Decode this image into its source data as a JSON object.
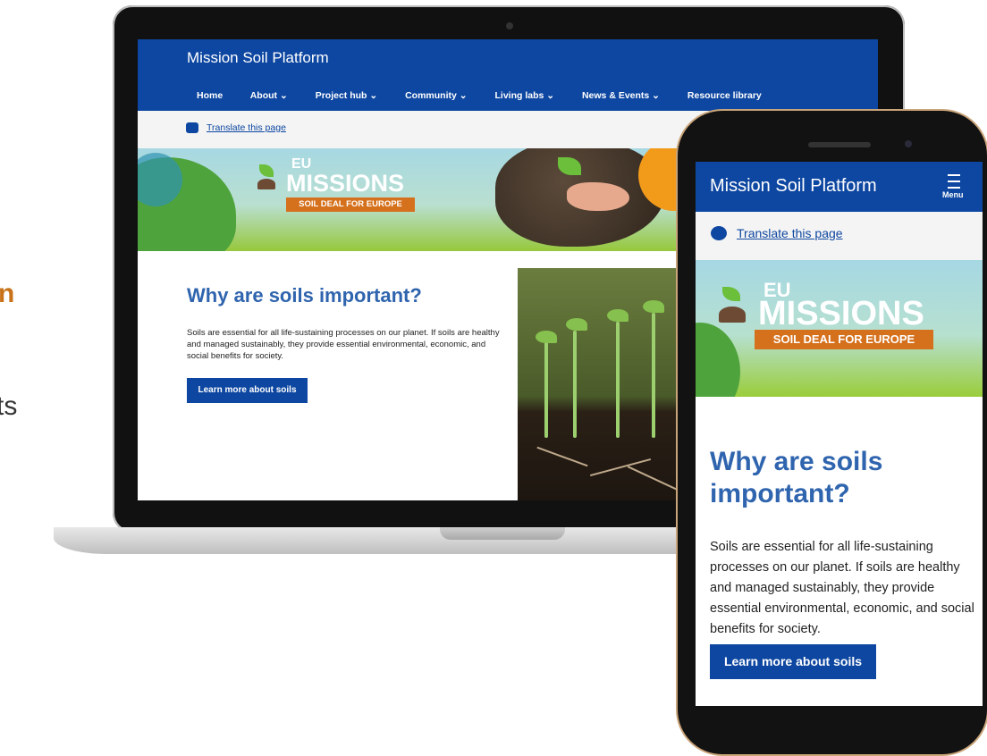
{
  "side_fragments": {
    "orange": "n",
    "gray": "ts"
  },
  "laptop": {
    "title": "Mission Soil Platform",
    "nav": [
      "Home",
      "About ⌄",
      "Project hub ⌄",
      "Community ⌄",
      "Living labs ⌄",
      "News & Events ⌄",
      "Resource library"
    ],
    "translate": "Translate this page",
    "logo": {
      "eu": "EU",
      "missions": "MISSIONS",
      "tagline": "SOIL DEAL FOR EUROPE"
    },
    "heading": "Why are soils important?",
    "paragraph": "Soils are essential for all life-sustaining processes on our planet. If soils are healthy and managed sustainably, they provide essential environmental, economic, and social benefits for society.",
    "button": "Learn more about soils"
  },
  "phone": {
    "title": "Mission Soil Platform",
    "menu": "Menu",
    "translate": "Translate this page",
    "logo": {
      "eu": "EU",
      "missions": "MISSIONS",
      "tagline": "SOIL DEAL FOR EUROPE"
    },
    "heading": "Why are soils important?",
    "paragraph": "Soils are essential for all life-sustaining processes on our planet. If soils are healthy and managed sustainably, they provide essential environmental, economic, and social benefits for society.",
    "button": "Learn more about soils"
  },
  "colors": {
    "brand_blue": "#0e47a1",
    "heading_blue": "#2f64ae",
    "accent_orange": "#d5701c"
  }
}
